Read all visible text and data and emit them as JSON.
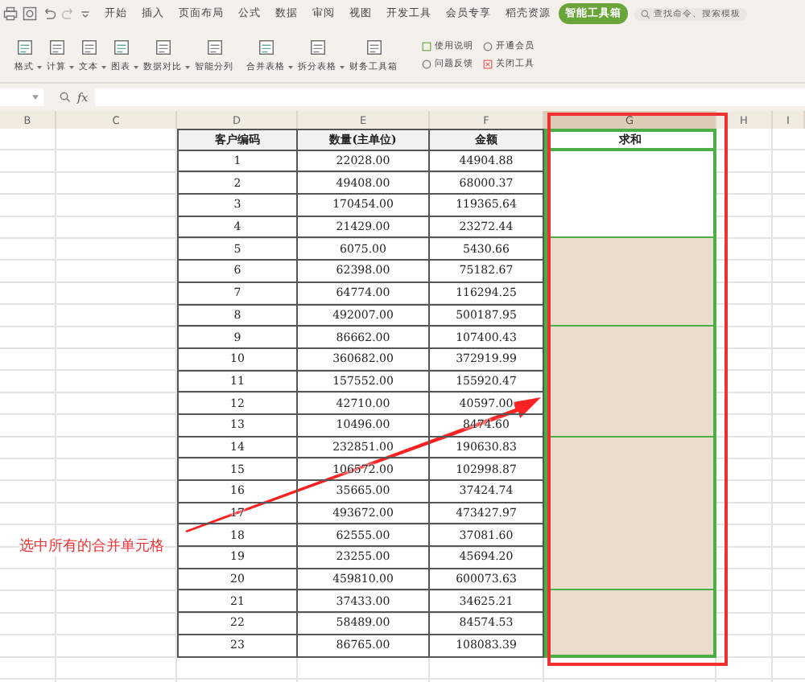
{
  "menu_tabs": [
    {
      "label": "开始",
      "selected": false
    },
    {
      "label": "插入",
      "selected": false
    },
    {
      "label": "页面布局",
      "selected": false
    },
    {
      "label": "公式",
      "selected": false
    },
    {
      "label": "数据",
      "selected": false
    },
    {
      "label": "审阅",
      "selected": false
    },
    {
      "label": "视图",
      "selected": false
    },
    {
      "label": "开发工具",
      "selected": false
    },
    {
      "label": "会员专享",
      "selected": false
    },
    {
      "label": "稻壳资源",
      "selected": false
    },
    {
      "label": "智能工具箱",
      "selected": true
    }
  ],
  "search": {
    "placeholder": "查找命令、搜索模板"
  },
  "ribbon": [
    {
      "label": "格式",
      "dropdown": true
    },
    {
      "label": "计算",
      "dropdown": true
    },
    {
      "label": "文本",
      "dropdown": true
    },
    {
      "label": "图表",
      "dropdown": true
    },
    {
      "label": "数据对比",
      "dropdown": true
    },
    {
      "label": "智能分列",
      "dropdown": false
    },
    {
      "label": "合并表格",
      "dropdown": true
    },
    {
      "label": "拆分表格",
      "dropdown": true
    },
    {
      "label": "财务工具箱",
      "dropdown": false
    }
  ],
  "ribbon_links": [
    {
      "label": "使用说明"
    },
    {
      "label": "开通会员"
    },
    {
      "label": "问题反馈"
    },
    {
      "label": "关闭工具"
    }
  ],
  "formula_bar": {
    "fx": "fx"
  },
  "columns": [
    {
      "label": "B",
      "selected": false
    },
    {
      "label": "C",
      "selected": false
    },
    {
      "label": "D",
      "selected": false
    },
    {
      "label": "E",
      "selected": false
    },
    {
      "label": "F",
      "selected": false
    },
    {
      "label": "G",
      "selected": true
    },
    {
      "label": "H",
      "selected": false
    },
    {
      "label": "I",
      "selected": false
    }
  ],
  "table": {
    "headers": [
      "客户编码",
      "数量(主单位)",
      "金额",
      "求和"
    ],
    "groups": [
      {
        "active": true,
        "rows": [
          [
            "1",
            "22028.00",
            "44904.88"
          ],
          [
            "2",
            "49408.00",
            "68000.37"
          ],
          [
            "3",
            "170454.00",
            "119365.64"
          ],
          [
            "4",
            "21429.00",
            "23272.44"
          ]
        ]
      },
      {
        "active": false,
        "rows": [
          [
            "5",
            "6075.00",
            "5430.66"
          ],
          [
            "6",
            "62398.00",
            "75182.67"
          ],
          [
            "7",
            "64774.00",
            "116294.25"
          ],
          [
            "8",
            "492007.00",
            "500187.95"
          ]
        ]
      },
      {
        "active": false,
        "rows": [
          [
            "9",
            "86662.00",
            "107400.43"
          ],
          [
            "10",
            "360682.00",
            "372919.99"
          ],
          [
            "11",
            "157552.00",
            "155920.47"
          ],
          [
            "12",
            "42710.00",
            "40597.00"
          ],
          [
            "13",
            "10496.00",
            "8474.60"
          ]
        ]
      },
      {
        "active": false,
        "rows": [
          [
            "14",
            "232851.00",
            "190630.83"
          ],
          [
            "15",
            "106572.00",
            "102998.87"
          ],
          [
            "16",
            "35665.00",
            "37424.74"
          ],
          [
            "17",
            "493672.00",
            "473427.97"
          ],
          [
            "18",
            "62555.00",
            "37081.60"
          ],
          [
            "19",
            "23255.00",
            "45694.20"
          ],
          [
            "20",
            "459810.00",
            "600073.63"
          ]
        ]
      },
      {
        "active": false,
        "rows": [
          [
            "21",
            "37433.00",
            "34625.21"
          ],
          [
            "22",
            "58489.00",
            "84574.53"
          ],
          [
            "23",
            "86765.00",
            "108083.39"
          ]
        ]
      }
    ]
  },
  "annotation": {
    "text": "选中所有的合并单元格"
  }
}
